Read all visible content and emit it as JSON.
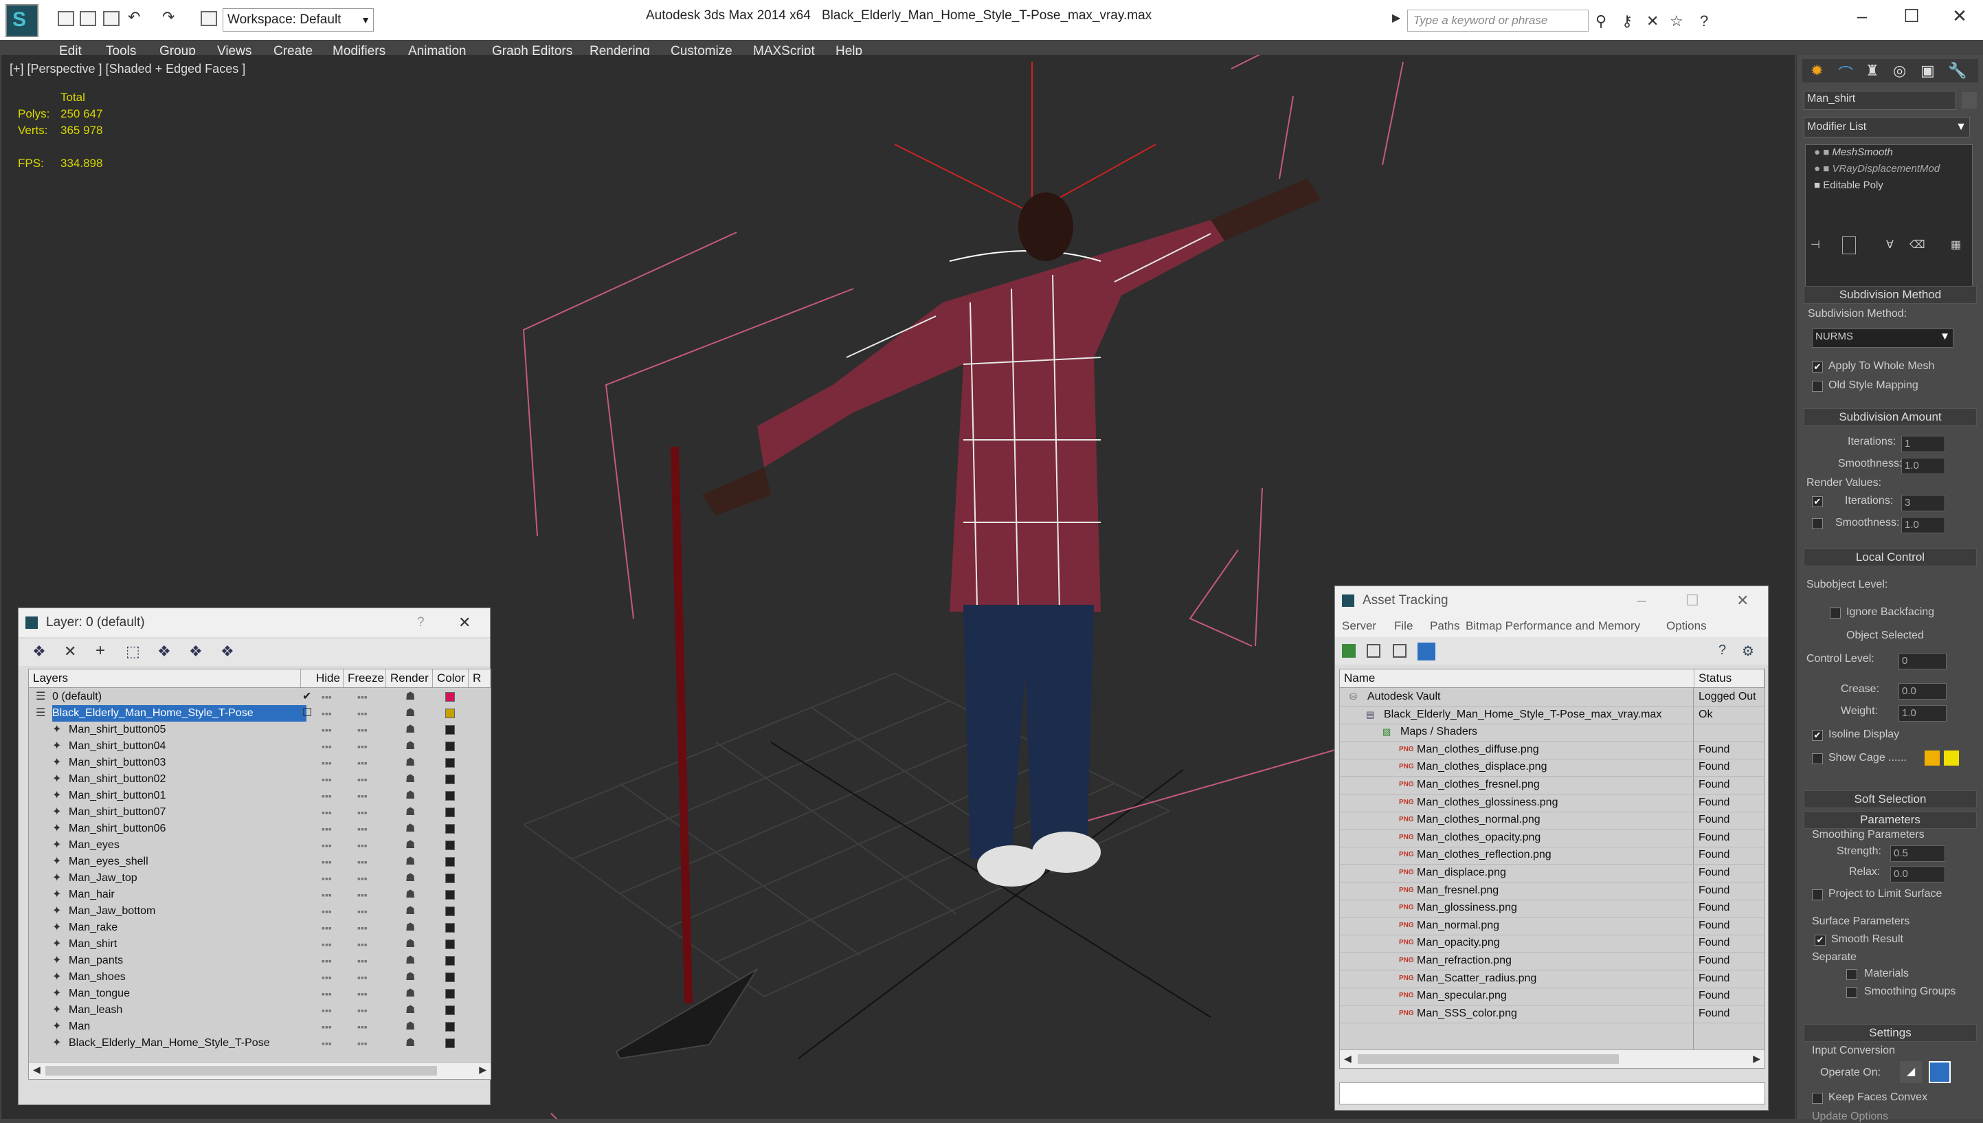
{
  "titlebar": {
    "workspace": "Workspace: Default",
    "app_name": "Autodesk 3ds Max  2014 x64",
    "file_name": "Black_Elderly_Man_Home_Style_T-Pose_max_vray.max",
    "search_placeholder": "Type a keyword or phrase"
  },
  "menu": [
    "Edit",
    "Tools",
    "Group",
    "Views",
    "Create",
    "Modifiers",
    "Animation",
    "Graph Editors",
    "Rendering",
    "Customize",
    "MAXScript",
    "Help"
  ],
  "viewport": {
    "label": "[+] [Perspective ] [Shaded + Edged Faces ]",
    "stats": {
      "total_label": "Total",
      "polys_label": "Polys:",
      "polys": "250 647",
      "verts_label": "Verts:",
      "verts": "365 978",
      "fps_label": "FPS:",
      "fps": "334.898"
    }
  },
  "layer_panel": {
    "title": "Layer: 0 (default)",
    "help": "?",
    "columns": [
      "Layers",
      "Hide",
      "Freeze",
      "Render",
      "Color",
      "R"
    ],
    "rows": [
      {
        "name": "0 (default)",
        "level": 0,
        "color": "#d4145a"
      },
      {
        "name": "Black_Elderly_Man_Home_Style_T-Pose",
        "level": 0,
        "color": "#c8a000",
        "selected": true
      },
      {
        "name": "Man_shirt_button05",
        "level": 1
      },
      {
        "name": "Man_shirt_button04",
        "level": 1
      },
      {
        "name": "Man_shirt_button03",
        "level": 1
      },
      {
        "name": "Man_shirt_button02",
        "level": 1
      },
      {
        "name": "Man_shirt_button01",
        "level": 1
      },
      {
        "name": "Man_shirt_button07",
        "level": 1
      },
      {
        "name": "Man_shirt_button06",
        "level": 1
      },
      {
        "name": "Man_eyes",
        "level": 1
      },
      {
        "name": "Man_eyes_shell",
        "level": 1
      },
      {
        "name": "Man_Jaw_top",
        "level": 1
      },
      {
        "name": "Man_hair",
        "level": 1
      },
      {
        "name": "Man_Jaw_bottom",
        "level": 1
      },
      {
        "name": "Man_rake",
        "level": 1
      },
      {
        "name": "Man_shirt",
        "level": 1
      },
      {
        "name": "Man_pants",
        "level": 1
      },
      {
        "name": "Man_shoes",
        "level": 1
      },
      {
        "name": "Man_tongue",
        "level": 1
      },
      {
        "name": "Man_leash",
        "level": 1
      },
      {
        "name": "Man",
        "level": 1
      },
      {
        "name": "Black_Elderly_Man_Home_Style_T-Pose",
        "level": 1
      }
    ]
  },
  "asset_panel": {
    "title": "Asset Tracking",
    "menu": [
      "Server",
      "File",
      "Paths",
      "Bitmap Performance and Memory",
      "Options"
    ],
    "columns": [
      "Name",
      "Status"
    ],
    "rows": [
      {
        "name": "Autodesk Vault",
        "status": "Logged Out",
        "level": 0
      },
      {
        "name": "Black_Elderly_Man_Home_Style_T-Pose_max_vray.max",
        "status": "Ok",
        "level": 1
      },
      {
        "name": "Maps / Shaders",
        "status": "",
        "level": 2
      },
      {
        "name": "Man_clothes_diffuse.png",
        "status": "Found",
        "level": 3
      },
      {
        "name": "Man_clothes_displace.png",
        "status": "Found",
        "level": 3
      },
      {
        "name": "Man_clothes_fresnel.png",
        "status": "Found",
        "level": 3
      },
      {
        "name": "Man_clothes_glossiness.png",
        "status": "Found",
        "level": 3
      },
      {
        "name": "Man_clothes_normal.png",
        "status": "Found",
        "level": 3
      },
      {
        "name": "Man_clothes_opacity.png",
        "status": "Found",
        "level": 3
      },
      {
        "name": "Man_clothes_reflection.png",
        "status": "Found",
        "level": 3
      },
      {
        "name": "Man_displace.png",
        "status": "Found",
        "level": 3
      },
      {
        "name": "Man_fresnel.png",
        "status": "Found",
        "level": 3
      },
      {
        "name": "Man_glossiness.png",
        "status": "Found",
        "level": 3
      },
      {
        "name": "Man_normal.png",
        "status": "Found",
        "level": 3
      },
      {
        "name": "Man_opacity.png",
        "status": "Found",
        "level": 3
      },
      {
        "name": "Man_refraction.png",
        "status": "Found",
        "level": 3
      },
      {
        "name": "Man_Scatter_radius.png",
        "status": "Found",
        "level": 3
      },
      {
        "name": "Man_specular.png",
        "status": "Found",
        "level": 3
      },
      {
        "name": "Man_SSS_color.png",
        "status": "Found",
        "level": 3
      }
    ]
  },
  "command_panel": {
    "object_name": "Man_shirt",
    "modifier_list": "Modifier List",
    "stack": [
      "MeshSmooth",
      "VRayDisplacementMod",
      "Editable Poly"
    ],
    "subdivision_method_title": "Subdivision Method",
    "subdivision_method_label": "Subdivision Method:",
    "subdivision_method_value": "NURMS",
    "apply_whole_mesh": "Apply To Whole Mesh",
    "old_style_mapping": "Old Style Mapping",
    "subdivision_amount_title": "Subdivision Amount",
    "iterations_label": "Iterations:",
    "iterations_value": "1",
    "smoothness_label": "Smoothness:",
    "smoothness_value": "1.0",
    "render_values_label": "Render Values:",
    "render_iterations_label": "Iterations:",
    "render_iterations_value": "3",
    "render_smoothness_label": "Smoothness:",
    "render_smoothness_value": "1.0",
    "local_control_title": "Local Control",
    "subobject_level_label": "Subobject Level:",
    "ignore_backfacing": "Ignore Backfacing",
    "object_selected": "Object Selected",
    "control_level_label": "Control Level:",
    "control_level_value": "0",
    "crease_label": "Crease:",
    "crease_value": "0.0",
    "weight_label": "Weight:",
    "weight_value": "1.0",
    "isoline_display": "Isoline Display",
    "show_cage": "Show Cage ......",
    "soft_selection_title": "Soft Selection",
    "parameters_title": "Parameters",
    "smoothing_parameters": "Smoothing Parameters",
    "strength_label": "Strength:",
    "strength_value": "0.5",
    "relax_label": "Relax:",
    "relax_value": "0.0",
    "project_limit": "Project to Limit Surface",
    "surface_parameters": "Surface Parameters",
    "smooth_result": "Smooth Result",
    "separate_label": "Separate",
    "materials": "Materials",
    "smoothing_groups": "Smoothing Groups",
    "settings_title": "Settings",
    "input_conversion": "Input Conversion",
    "operate_on_label": "Operate On:",
    "keep_faces_convex": "Keep Faces Convex",
    "update_options": "Update Options"
  }
}
